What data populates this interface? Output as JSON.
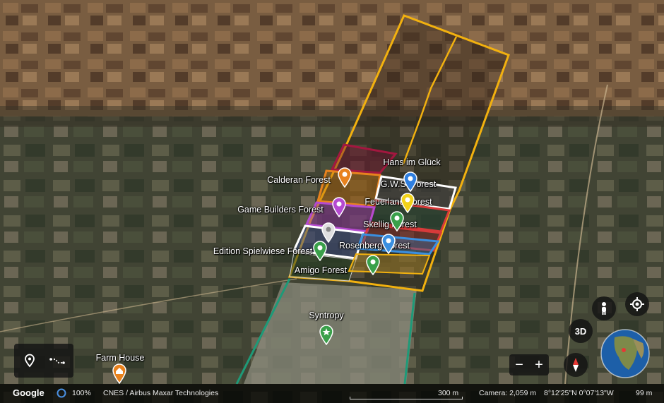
{
  "map": {
    "places": [
      {
        "name": "Hans im Glück"
      },
      {
        "name": "Calderan Forest",
        "pin_color": "#e8821e"
      },
      {
        "name": "G.W.S. Forest",
        "pin_color": "#2f7fe0"
      },
      {
        "name": "Feuerland Forest",
        "pin_color": "#f2d21a"
      },
      {
        "name": "Game Builders Forest",
        "pin_color": "#b54ad0"
      },
      {
        "name": "Skellig Forest",
        "pin_color": "#3aa04a"
      },
      {
        "name": "Rosenberg Forest",
        "pin_color": "#3a8fe0"
      },
      {
        "name": "Edition Spielwiese Forest",
        "pin_color": "#3aa04a"
      },
      {
        "name": "Amigo Forest",
        "pin_color": "#3aa04a"
      },
      {
        "name": "Syntropy",
        "pin_color": "#3aa04a"
      },
      {
        "name": "Farm House",
        "pin_color": "#e8821e"
      }
    ],
    "outline_colors": {
      "main": "#f2b10f",
      "hans": "#a3173f",
      "calderan": "#e8821e",
      "gws": "#ffffff",
      "game_builders": "#b54ad0",
      "skellig": "#d83a3a",
      "rosenberg": "#3a8fe0",
      "edition": "#ffffff",
      "track": "#1e9a78"
    }
  },
  "controls": {
    "left_tools": [
      "location-pin-icon",
      "path-icon"
    ],
    "streetview": "pegman-icon",
    "my_location": "target-icon",
    "view_3d": "3D",
    "zoom_out": "−",
    "zoom_in": "+",
    "compass": "compass-icon",
    "globe": "globe-icon"
  },
  "status_bar": {
    "logo": "Google",
    "zoom_percent": "100%",
    "attribution": "CNES / Airbus   Maxar Technologies",
    "scale": "300 m",
    "camera": "Camera: 2,059 m",
    "coordinates": "8°12'25\"N 0°07'13\"W",
    "elevation": "99 m"
  }
}
